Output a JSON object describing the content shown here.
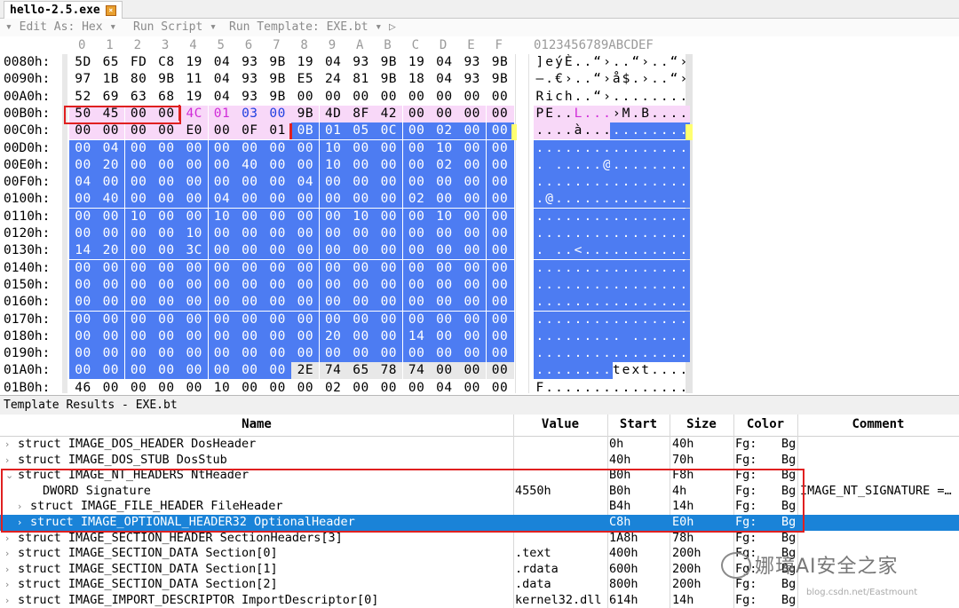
{
  "tab": {
    "title": "hello-2.5.exe"
  },
  "toolbar": {
    "edit_as": "▾ Edit As: Hex ▾",
    "run_script": "Run Script ▾",
    "run_template": "Run Template: EXE.bt ▾ ▷"
  },
  "hex": {
    "col_headers": [
      "0",
      "1",
      "2",
      "3",
      "4",
      "5",
      "6",
      "7",
      "8",
      "9",
      "A",
      "B",
      "C",
      "D",
      "E",
      "F"
    ],
    "ascii_header": "0123456789ABCDEF",
    "rows": [
      {
        "addr": "0080h:",
        "bytes": [
          "5D",
          "65",
          "FD",
          "C8",
          "19",
          "04",
          "93",
          "9B",
          "19",
          "04",
          "93",
          "9B",
          "19",
          "04",
          "93",
          "9B"
        ],
        "ascii": "]eýÈ..“›..“›..“›"
      },
      {
        "addr": "0090h:",
        "bytes": [
          "97",
          "1B",
          "80",
          "9B",
          "11",
          "04",
          "93",
          "9B",
          "E5",
          "24",
          "81",
          "9B",
          "18",
          "04",
          "93",
          "9B"
        ],
        "ascii": "—.€›..“›å$.›..“›"
      },
      {
        "addr": "00A0h:",
        "bytes": [
          "52",
          "69",
          "63",
          "68",
          "19",
          "04",
          "93",
          "9B",
          "00",
          "00",
          "00",
          "00",
          "00",
          "00",
          "00",
          "00"
        ],
        "ascii": "Rich..“›........"
      },
      {
        "addr": "00B0h:",
        "bytes": [
          "50",
          "45",
          "00",
          "00",
          "4C",
          "01",
          "03",
          "00",
          "9B",
          "4D",
          "8F",
          "42",
          "00",
          "00",
          "00",
          "00"
        ],
        "ascii": "PE..L...›M.B...."
      },
      {
        "addr": "00C0h:",
        "bytes": [
          "00",
          "00",
          "00",
          "00",
          "E0",
          "00",
          "0F",
          "01",
          "0B",
          "01",
          "05",
          "0C",
          "00",
          "02",
          "00",
          "00"
        ],
        "ascii": "....à..........."
      },
      {
        "addr": "00D0h:",
        "bytes": [
          "00",
          "04",
          "00",
          "00",
          "00",
          "00",
          "00",
          "00",
          "00",
          "10",
          "00",
          "00",
          "00",
          "10",
          "00",
          "00"
        ],
        "ascii": "................"
      },
      {
        "addr": "00E0h:",
        "bytes": [
          "00",
          "20",
          "00",
          "00",
          "00",
          "00",
          "40",
          "00",
          "00",
          "10",
          "00",
          "00",
          "00",
          "02",
          "00",
          "00"
        ],
        "ascii": ". .....@........"
      },
      {
        "addr": "00F0h:",
        "bytes": [
          "04",
          "00",
          "00",
          "00",
          "00",
          "00",
          "00",
          "00",
          "04",
          "00",
          "00",
          "00",
          "00",
          "00",
          "00",
          "00"
        ],
        "ascii": "................"
      },
      {
        "addr": "0100h:",
        "bytes": [
          "00",
          "40",
          "00",
          "00",
          "00",
          "04",
          "00",
          "00",
          "00",
          "00",
          "00",
          "00",
          "02",
          "00",
          "00",
          "00"
        ],
        "ascii": ".@.............."
      },
      {
        "addr": "0110h:",
        "bytes": [
          "00",
          "00",
          "10",
          "00",
          "00",
          "10",
          "00",
          "00",
          "00",
          "00",
          "10",
          "00",
          "00",
          "10",
          "00",
          "00"
        ],
        "ascii": "................"
      },
      {
        "addr": "0120h:",
        "bytes": [
          "00",
          "00",
          "00",
          "00",
          "10",
          "00",
          "00",
          "00",
          "00",
          "00",
          "00",
          "00",
          "00",
          "00",
          "00",
          "00"
        ],
        "ascii": "................"
      },
      {
        "addr": "0130h:",
        "bytes": [
          "14",
          "20",
          "00",
          "00",
          "3C",
          "00",
          "00",
          "00",
          "00",
          "00",
          "00",
          "00",
          "00",
          "00",
          "00",
          "00"
        ],
        "ascii": ". ..<..........."
      },
      {
        "addr": "0140h:",
        "bytes": [
          "00",
          "00",
          "00",
          "00",
          "00",
          "00",
          "00",
          "00",
          "00",
          "00",
          "00",
          "00",
          "00",
          "00",
          "00",
          "00"
        ],
        "ascii": "................"
      },
      {
        "addr": "0150h:",
        "bytes": [
          "00",
          "00",
          "00",
          "00",
          "00",
          "00",
          "00",
          "00",
          "00",
          "00",
          "00",
          "00",
          "00",
          "00",
          "00",
          "00"
        ],
        "ascii": "................"
      },
      {
        "addr": "0160h:",
        "bytes": [
          "00",
          "00",
          "00",
          "00",
          "00",
          "00",
          "00",
          "00",
          "00",
          "00",
          "00",
          "00",
          "00",
          "00",
          "00",
          "00"
        ],
        "ascii": "................"
      },
      {
        "addr": "0170h:",
        "bytes": [
          "00",
          "00",
          "00",
          "00",
          "00",
          "00",
          "00",
          "00",
          "00",
          "00",
          "00",
          "00",
          "00",
          "00",
          "00",
          "00"
        ],
        "ascii": "................"
      },
      {
        "addr": "0180h:",
        "bytes": [
          "00",
          "00",
          "00",
          "00",
          "00",
          "00",
          "00",
          "00",
          "00",
          "20",
          "00",
          "00",
          "14",
          "00",
          "00",
          "00"
        ],
        "ascii": "......... ......"
      },
      {
        "addr": "0190h:",
        "bytes": [
          "00",
          "00",
          "00",
          "00",
          "00",
          "00",
          "00",
          "00",
          "00",
          "00",
          "00",
          "00",
          "00",
          "00",
          "00",
          "00"
        ],
        "ascii": "................"
      },
      {
        "addr": "01A0h:",
        "bytes": [
          "00",
          "00",
          "00",
          "00",
          "00",
          "00",
          "00",
          "00",
          "2E",
          "74",
          "65",
          "78",
          "74",
          "00",
          "00",
          "00"
        ],
        "ascii": "........text...."
      },
      {
        "addr": "01B0h:",
        "bytes": [
          "46",
          "00",
          "00",
          "00",
          "00",
          "10",
          "00",
          "00",
          "00",
          "02",
          "00",
          "00",
          "00",
          "04",
          "00",
          "00"
        ],
        "ascii": "F..............."
      }
    ]
  },
  "template": {
    "panel_title": "Template Results - EXE.bt",
    "columns": [
      "Name",
      "Value",
      "Start",
      "Size",
      "Color",
      "Comment"
    ],
    "rows": [
      {
        "name": "struct IMAGE_DOS_HEADER DosHeader",
        "value": "",
        "start": "0h",
        "size": "40h",
        "fg": "Fg:",
        "bg": "Bg",
        "comment": "",
        "indent": 0,
        "chev": "›"
      },
      {
        "name": "struct IMAGE_DOS_STUB DosStub",
        "value": "",
        "start": "40h",
        "size": "70h",
        "fg": "Fg:",
        "bg": "Bg",
        "comment": "",
        "indent": 0,
        "chev": "›"
      },
      {
        "name": "struct IMAGE_NT_HEADERS NtHeader",
        "value": "",
        "start": "B0h",
        "size": "F8h",
        "fg": "Fg:",
        "bg": "Bg",
        "comment": "",
        "indent": 0,
        "chev": "⌄"
      },
      {
        "name": "DWORD Signature",
        "value": "4550h",
        "start": "B0h",
        "size": "4h",
        "fg": "Fg:",
        "bg": "Bg",
        "comment": "IMAGE_NT_SIGNATURE =…",
        "indent": 2,
        "chev": ""
      },
      {
        "name": "struct IMAGE_FILE_HEADER FileHeader",
        "value": "",
        "start": "B4h",
        "size": "14h",
        "fg": "Fg:",
        "bg": "Bg",
        "comment": "",
        "indent": 1,
        "chev": "›"
      },
      {
        "name": "struct IMAGE_OPTIONAL_HEADER32 OptionalHeader",
        "value": "",
        "start": "C8h",
        "size": "E0h",
        "fg": "Fg:",
        "bg": "Bg",
        "comment": "",
        "indent": 1,
        "chev": "›"
      },
      {
        "name": "struct IMAGE_SECTION_HEADER SectionHeaders[3]",
        "value": "",
        "start": "1A8h",
        "size": "78h",
        "fg": "Fg:",
        "bg": "Bg",
        "comment": "",
        "indent": 0,
        "chev": "›"
      },
      {
        "name": "struct IMAGE_SECTION_DATA Section[0]",
        "value": ".text",
        "start": "400h",
        "size": "200h",
        "fg": "Fg:",
        "bg": "Bg",
        "comment": "",
        "indent": 0,
        "chev": "›"
      },
      {
        "name": "struct IMAGE_SECTION_DATA Section[1]",
        "value": ".rdata",
        "start": "600h",
        "size": "200h",
        "fg": "Fg:",
        "bg": "Bg",
        "comment": "",
        "indent": 0,
        "chev": "›"
      },
      {
        "name": "struct IMAGE_SECTION_DATA Section[2]",
        "value": ".data",
        "start": "800h",
        "size": "200h",
        "fg": "Fg:",
        "bg": "Bg",
        "comment": "",
        "indent": 0,
        "chev": "›"
      },
      {
        "name": "struct IMAGE_IMPORT_DESCRIPTOR ImportDescriptor[0]",
        "value": "kernel32.dll",
        "start": "614h",
        "size": "14h",
        "fg": "Fg:",
        "bg": "Bg",
        "comment": "",
        "indent": 0,
        "chev": "›"
      }
    ],
    "selected_row": 5
  },
  "watermark": {
    "text": "娜璋AI安全之家",
    "sub": "blog.csdn.net/Eastmount"
  },
  "colors": {
    "selection_blue": "#4d7cf2",
    "pink": "#f8d8f8",
    "magenta_text": "#d02cd8",
    "blue_text": "#2040e0",
    "row_select": "#1a83d8",
    "highlight_red": "#e02020"
  }
}
